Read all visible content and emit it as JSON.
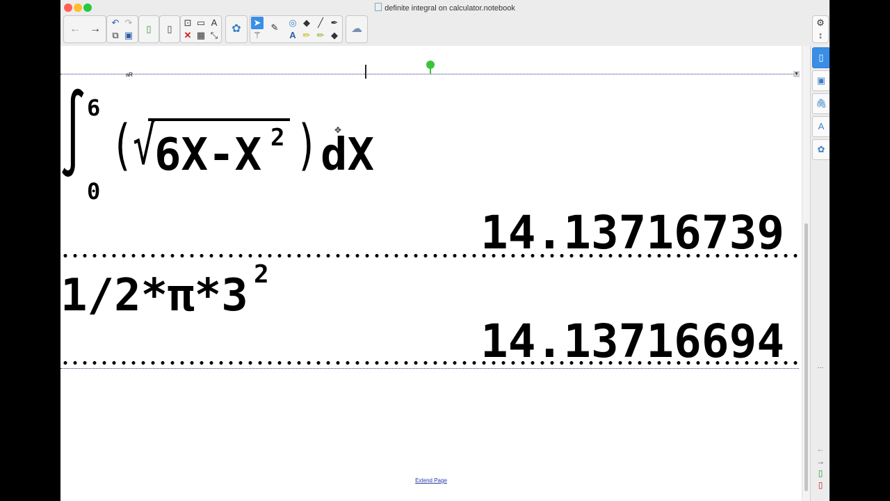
{
  "window": {
    "title": "definite integral on calculator.notebook",
    "buttons": {
      "close_color": "#ff5f57",
      "minimize_color": "#febc2e",
      "zoom_color": "#28c840"
    }
  },
  "toolbar": {
    "icons": [
      "back-arrow",
      "forward-arrow",
      "undo",
      "redo",
      "clear-page",
      "save",
      "new-page",
      "insert-page",
      "screen-capture",
      "delete",
      "screen-shade",
      "table",
      "text-tool-options",
      "fit-page",
      "select",
      "pen",
      "shapes",
      "fill",
      "line",
      "marker",
      "magic-pen",
      "text",
      "highlighter",
      "eraser",
      "creative-pen",
      "properties"
    ]
  },
  "calculator": {
    "integral": {
      "upper_limit": "6",
      "lower_limit": "0",
      "expression": "(√6X-X²)dX",
      "radicand_main": "6X-X",
      "exponent": "2",
      "differential": "dX",
      "result": "14.13716739"
    },
    "formula": {
      "expression_main": "1/2*π*3",
      "exponent": "2",
      "result": "14.13716694"
    }
  },
  "page": {
    "extend_link": "Extend Page",
    "accent_color": "#3a8ee6"
  },
  "sidebar": {
    "tabs": [
      "page-sorter",
      "gallery",
      "attachments",
      "properties",
      "add-ons"
    ]
  }
}
